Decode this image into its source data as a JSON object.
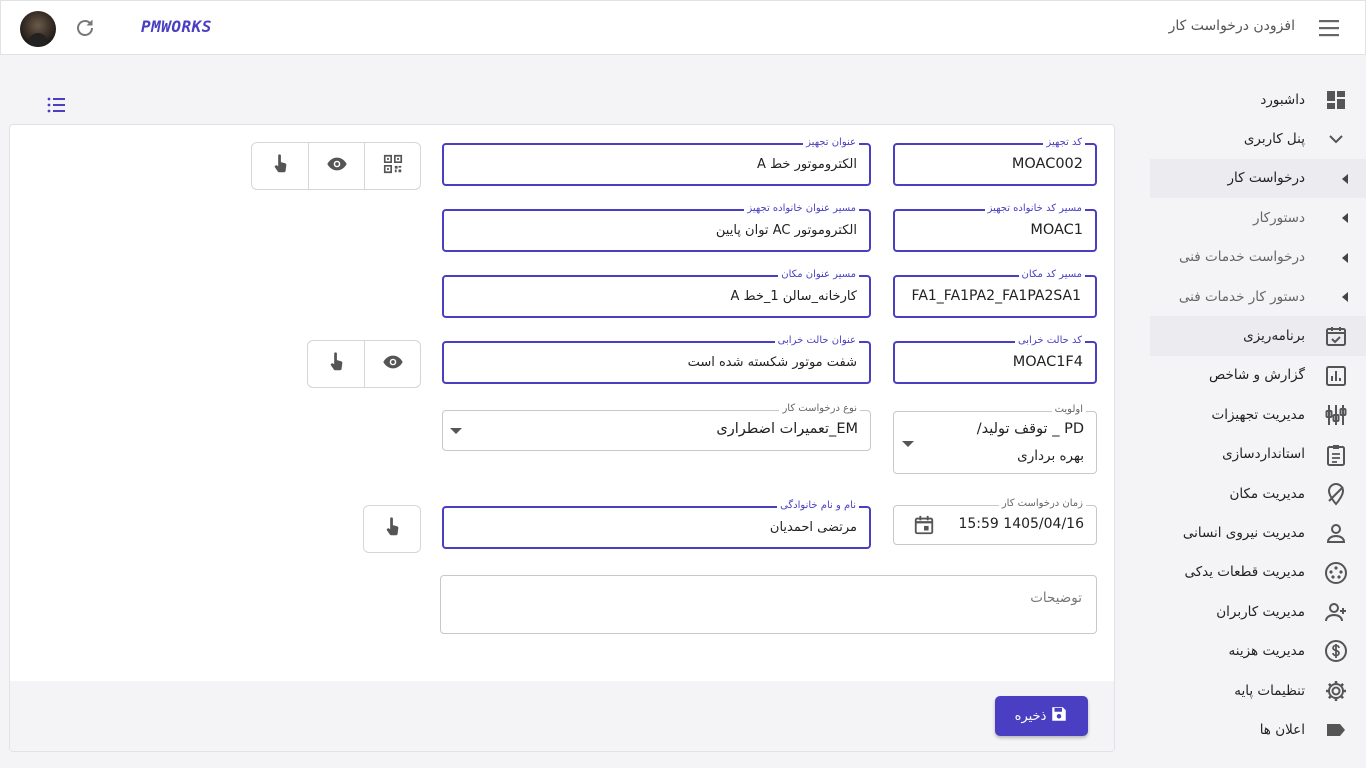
{
  "header": {
    "logo": "PMWORKS",
    "title": "افزودن درخواست کار",
    "avatar_icon": "user-avatar",
    "refresh_icon": "refresh-icon",
    "menu_icon": "hamburger-icon"
  },
  "sidebar": {
    "items": [
      {
        "label": "داشبورد",
        "icon": "dashboard-icon"
      },
      {
        "label": "پنل کاربری",
        "icon": "chevron-down-icon"
      },
      {
        "label": "درخواست کار",
        "icon": "caret-left-icon"
      },
      {
        "label": "دستورکار",
        "icon": "caret-left-icon"
      },
      {
        "label": "درخواست خدمات فنی",
        "icon": "caret-left-icon"
      },
      {
        "label": "دستور کار خدمات فنی",
        "icon": "caret-left-icon"
      },
      {
        "label": "برنامه‌ریزی",
        "icon": "calendar-check-icon"
      },
      {
        "label": "گزارش و شاخص",
        "icon": "bar-chart-icon"
      },
      {
        "label": "مدیریت تجهیزات",
        "icon": "equipment-icon"
      },
      {
        "label": "استانداردسازی",
        "icon": "clipboard-icon"
      },
      {
        "label": "مدیریت مکان",
        "icon": "location-icon"
      },
      {
        "label": "مدیریت نیروی انسانی",
        "icon": "person-icon"
      },
      {
        "label": "مدیریت قطعات یدکی",
        "icon": "spare-parts-icon"
      },
      {
        "label": "مدیریت کاربران",
        "icon": "person-add-icon"
      },
      {
        "label": "مدیریت هزینه",
        "icon": "dollar-icon"
      },
      {
        "label": "تنظیمات پایه",
        "icon": "gear-icon"
      },
      {
        "label": "اعلان ها",
        "icon": "label-icon"
      }
    ]
  },
  "form": {
    "equipment_code": {
      "label": "کد تجهیز",
      "value": "MOAC002"
    },
    "equipment_title": {
      "label": "عنوان تجهیز",
      "value": "الکتروموتور خط A"
    },
    "family_code_path": {
      "label": "مسیر کد خانواده تجهیز",
      "value": "MOAC1"
    },
    "family_title_path": {
      "label": "مسیر عنوان خانواده تجهیز",
      "value": "الکتروموتور AC توان پایین"
    },
    "location_code_path": {
      "label": "مسیر کد مکان",
      "value": "FA1_FA1PA2_FA1PA2SA1"
    },
    "location_title_path": {
      "label": "مسیر عنوان مکان",
      "value": "کارخانه_سالن 1_خط A"
    },
    "failure_code": {
      "label": "کد حالت خرابی",
      "value": "MOAC1F4"
    },
    "failure_title": {
      "label": "عنوان حالت خرابی",
      "value": "شفت موتور شکسته شده است"
    },
    "priority": {
      "label": "اولویت",
      "value_line1": "PD _ توقف تولید/",
      "value_line2": "بهره برداری"
    },
    "request_type": {
      "label": "نوع درخواست کار",
      "value": "EM_تعمیرات اضطراری"
    },
    "request_time": {
      "label": "زمان درخواست کار",
      "value": "1405/04/16 15:59"
    },
    "full_name": {
      "label": "نام و نام خانوادگی",
      "value": "مرتضی احمدیان"
    },
    "description": {
      "placeholder": "توضیحات"
    }
  },
  "buttons": {
    "save_label": "ذخیره"
  }
}
